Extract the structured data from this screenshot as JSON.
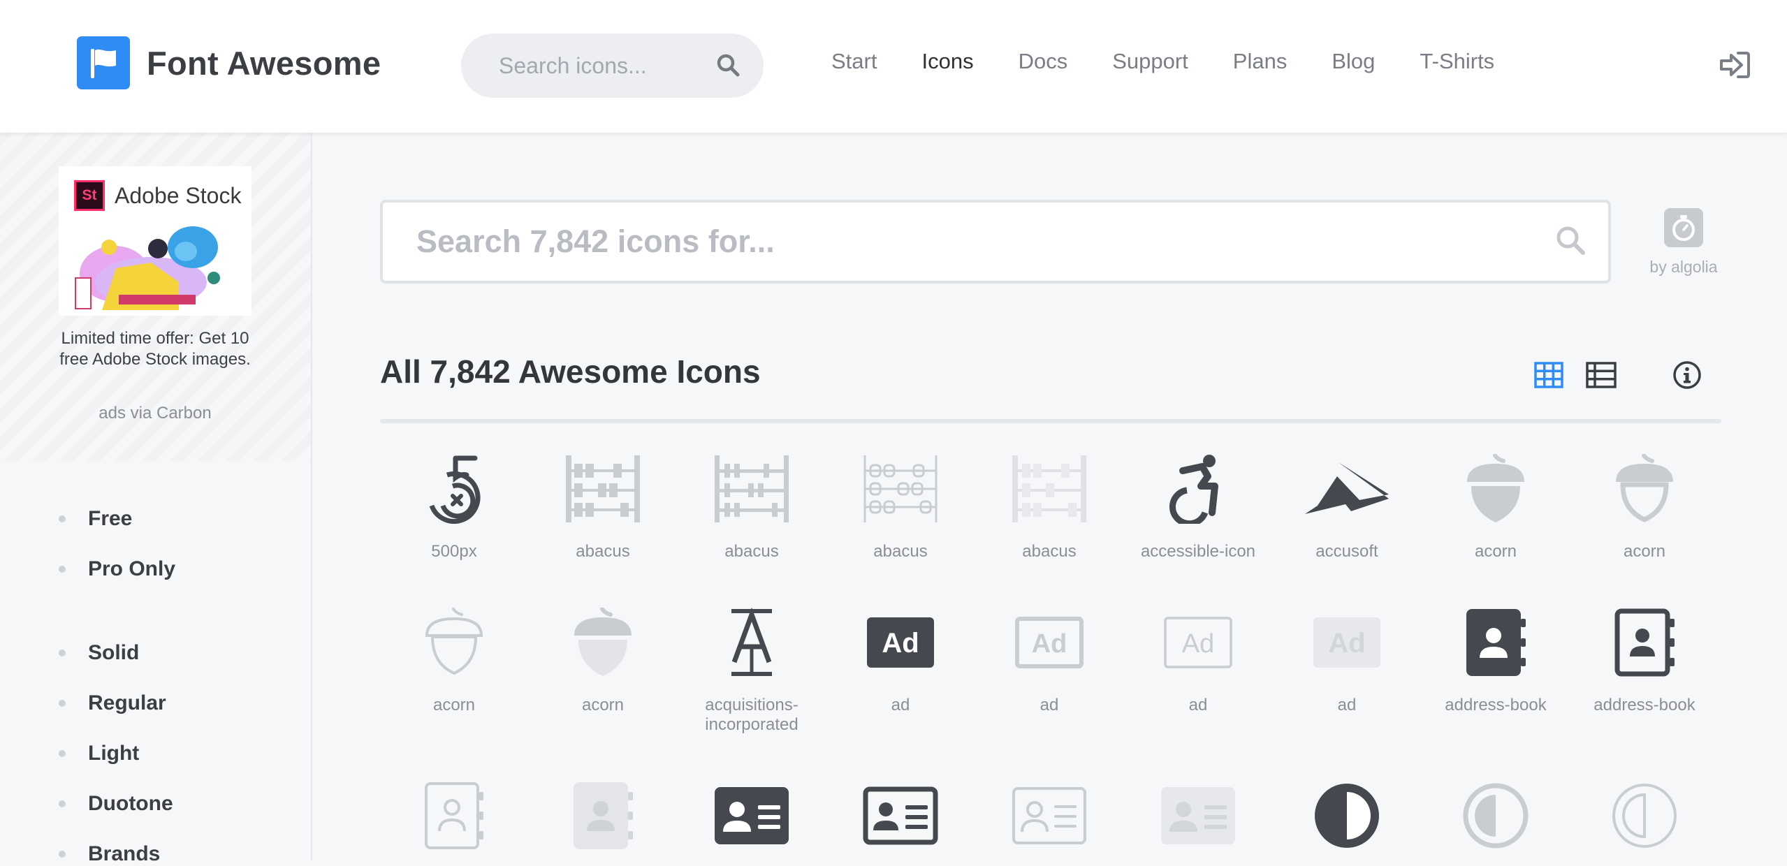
{
  "header": {
    "brand_name": "Font Awesome",
    "search_placeholder": "Search icons...",
    "nav": [
      "Start",
      "Icons",
      "Docs",
      "Support",
      "Plans",
      "Blog",
      "T-Shirts"
    ],
    "active_nav": "Icons"
  },
  "sidebar": {
    "ad": {
      "brand": "Adobe Stock",
      "logo_text": "St",
      "text": "Limited time offer: Get 10 free Adobe Stock images.",
      "via": "ads via Carbon"
    },
    "license_filters": [
      "Free",
      "Pro Only"
    ],
    "style_filters": [
      "Solid",
      "Regular",
      "Light",
      "Duotone",
      "Brands"
    ]
  },
  "main": {
    "search_placeholder": "Search 7,842 icons for...",
    "algolia_label": "by algolia",
    "title": "All 7,842 Awesome Icons",
    "icons": [
      {
        "label": "500px",
        "icon": "500px-icon",
        "tone": "#45484e"
      },
      {
        "label": "abacus",
        "icon": "abacus-solid-icon",
        "tone": "#c9ccd1"
      },
      {
        "label": "abacus",
        "icon": "abacus-regular-icon",
        "tone": "#c9ccd1"
      },
      {
        "label": "abacus",
        "icon": "abacus-light-icon",
        "tone": "#c9ccd1"
      },
      {
        "label": "abacus",
        "icon": "abacus-duotone-icon",
        "tone": "#dfe1e5"
      },
      {
        "label": "accessible-icon",
        "icon": "accessible-icon",
        "tone": "#45484e"
      },
      {
        "label": "accusoft",
        "icon": "accusoft-icon",
        "tone": "#45484e"
      },
      {
        "label": "acorn",
        "icon": "acorn-solid-icon",
        "tone": "#c9ccd1"
      },
      {
        "label": "acorn",
        "icon": "acorn-regular-icon",
        "tone": "#c9ccd1"
      },
      {
        "label": "acorn",
        "icon": "acorn-light-icon",
        "tone": "#c9ccd1"
      },
      {
        "label": "acorn",
        "icon": "acorn-duotone-icon",
        "tone": "#c9ccd1"
      },
      {
        "label": "acquisitions-incorporated",
        "icon": "acquisitions-incorporated-icon",
        "tone": "#45484e"
      },
      {
        "label": "ad",
        "icon": "ad-solid-icon",
        "tone": "#45484e"
      },
      {
        "label": "ad",
        "icon": "ad-regular-icon",
        "tone": "#c9ccd1"
      },
      {
        "label": "ad",
        "icon": "ad-light-icon",
        "tone": "#c9ccd1"
      },
      {
        "label": "ad",
        "icon": "ad-duotone-icon",
        "tone": "#dfe1e5"
      },
      {
        "label": "address-book",
        "icon": "address-book-solid-icon",
        "tone": "#45484e"
      },
      {
        "label": "address-book",
        "icon": "address-book-regular-icon",
        "tone": "#45484e"
      },
      {
        "label": "",
        "icon": "address-book-light-icon",
        "tone": "#c9ccd1"
      },
      {
        "label": "",
        "icon": "address-book-duotone-icon",
        "tone": "#dfe1e5"
      },
      {
        "label": "",
        "icon": "address-card-solid-icon",
        "tone": "#45484e"
      },
      {
        "label": "",
        "icon": "address-card-regular-icon",
        "tone": "#45484e"
      },
      {
        "label": "",
        "icon": "address-card-light-icon",
        "tone": "#c9ccd1"
      },
      {
        "label": "",
        "icon": "address-card-duotone-icon",
        "tone": "#dfe1e5"
      },
      {
        "label": "",
        "icon": "adjust-solid-icon",
        "tone": "#45484e"
      },
      {
        "label": "",
        "icon": "adjust-regular-icon",
        "tone": "#c9ccd1"
      },
      {
        "label": "",
        "icon": "adjust-light-icon",
        "tone": "#c9ccd1"
      }
    ]
  },
  "colors": {
    "accent": "#2f8cf5",
    "dark_icon": "#45484e",
    "light_icon": "#c9ccd1"
  }
}
